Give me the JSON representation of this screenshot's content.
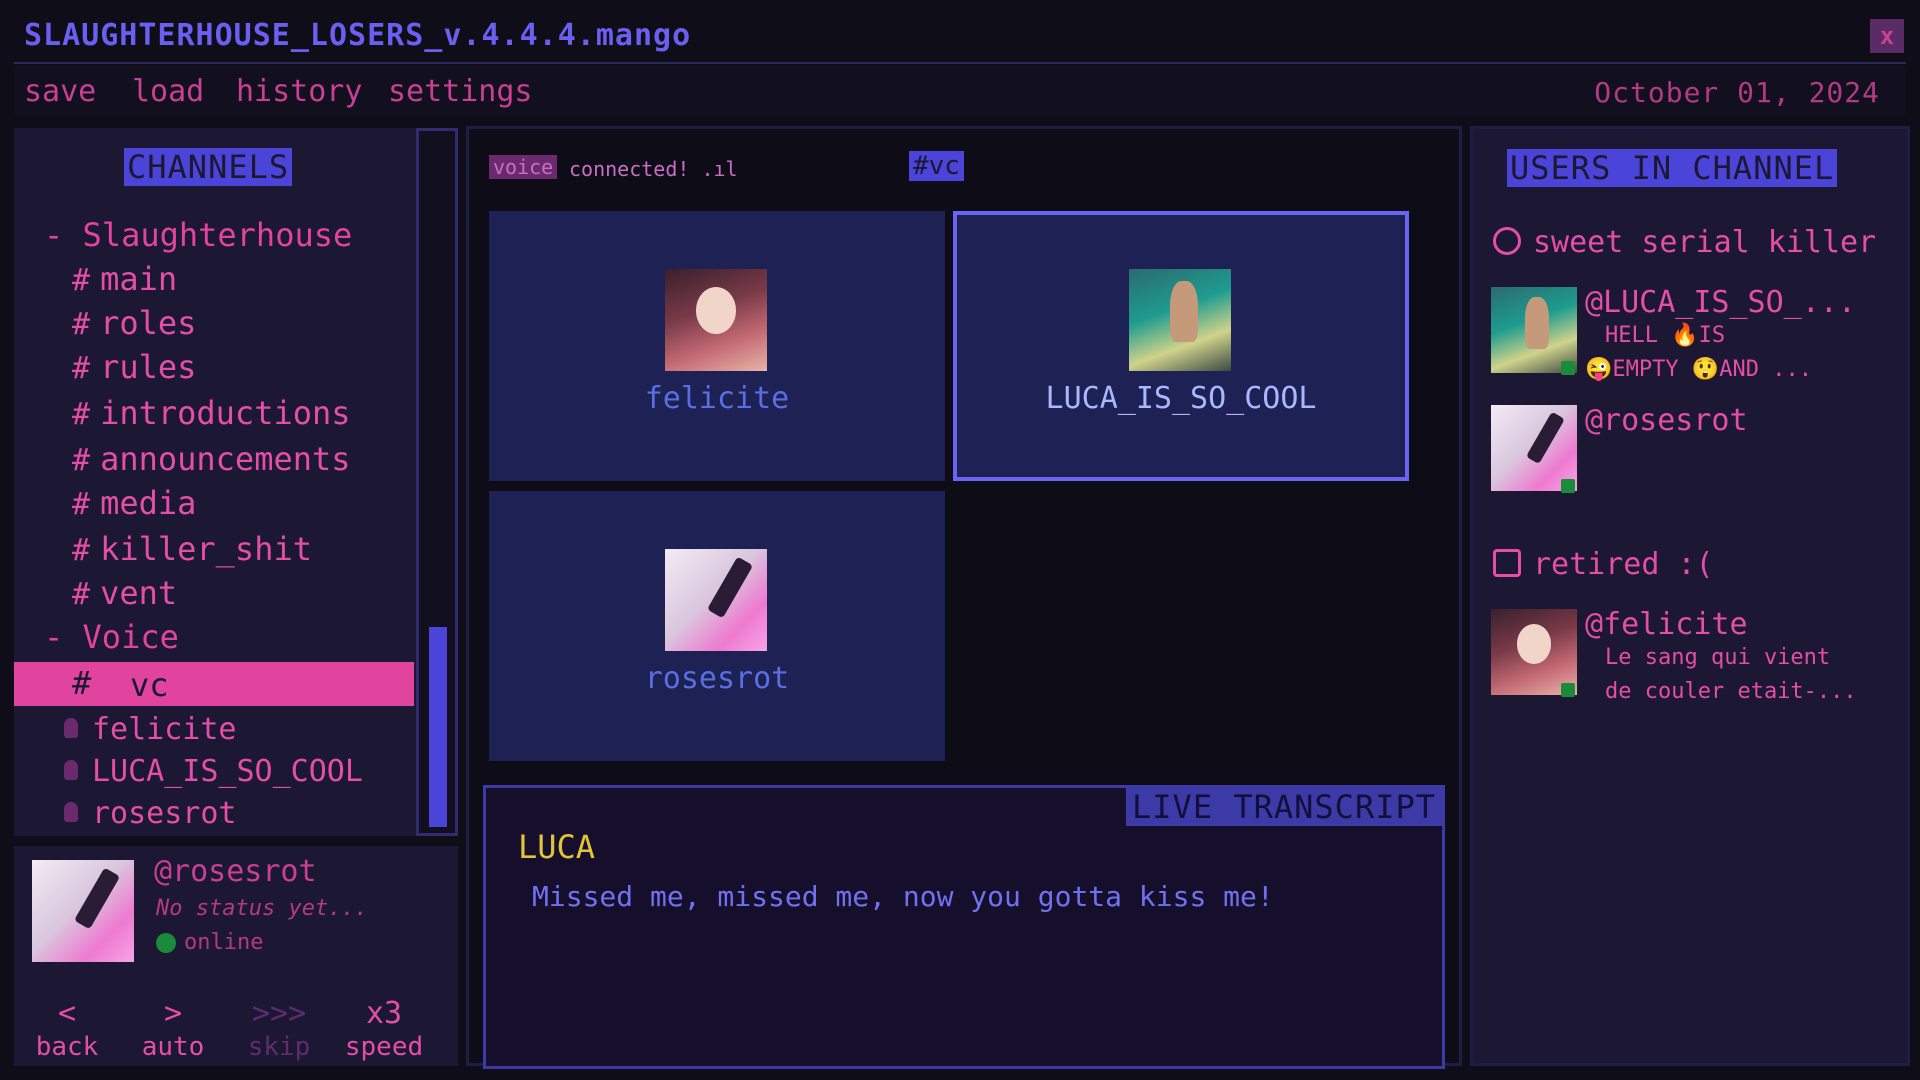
{
  "window": {
    "title": "SLAUGHTERHOUSE_LOSERS_v.4.4.4.mango",
    "close_label": "x"
  },
  "menu": {
    "items": [
      "save",
      "load",
      "history",
      "settings"
    ],
    "date": "October 01, 2024"
  },
  "channels": {
    "header": "CHANNELS",
    "server": "- Slaughterhouse",
    "text_channels": [
      "main",
      "roles",
      "rules",
      "introductions",
      "announcements",
      "media",
      "killer_shit",
      "vent"
    ],
    "voice_category": "- Voice",
    "voice_channel": "vc",
    "voice_users": [
      "felicite",
      "LUCA_IS_SO_COOL",
      "rosesrot"
    ],
    "scroll_fraction": 0.7
  },
  "profile": {
    "name": "@rosesrot",
    "status": "No status yet...",
    "presence": "online"
  },
  "controls": [
    {
      "symbol": "<",
      "label": "back"
    },
    {
      "symbol": ">",
      "label": "auto"
    },
    {
      "symbol": ">>>",
      "label": "skip"
    },
    {
      "symbol": "x3",
      "label": "speed"
    }
  ],
  "voice": {
    "tag": "voice",
    "connection": "connected! .ıl",
    "channel_tag": "#vc",
    "participants": [
      "felicite",
      "LUCA_IS_SO_COOL",
      "rosesrot"
    ],
    "active_speaker": "LUCA_IS_SO_COOL"
  },
  "transcript": {
    "header": "LIVE TRANSCRIPT",
    "speaker": "LUCA",
    "text": "Missed me, missed me, now you gotta kiss me!"
  },
  "users": {
    "header": "USERS IN CHANNEL",
    "groups": [
      {
        "title": "sweet serial killer",
        "icon": "smiley-icon",
        "members": [
          {
            "name": "@LUCA_IS_SO_...",
            "status_line1": "HELL 🔥IS",
            "status_line2": "😜EMPTY 😲AND ..."
          },
          {
            "name": "@rosesrot"
          }
        ]
      },
      {
        "title": "retired :(",
        "icon": "thumbs-down-icon",
        "members": [
          {
            "name": "@felicite",
            "status_line1": "Le sang qui vient",
            "status_line2": "de couler etait-..."
          }
        ]
      }
    ]
  },
  "colors": {
    "accent_pink": "#e0449f",
    "accent_blue": "#4a45d8",
    "online_green": "#1a8b3b",
    "speaker_yellow": "#e3c33a"
  }
}
